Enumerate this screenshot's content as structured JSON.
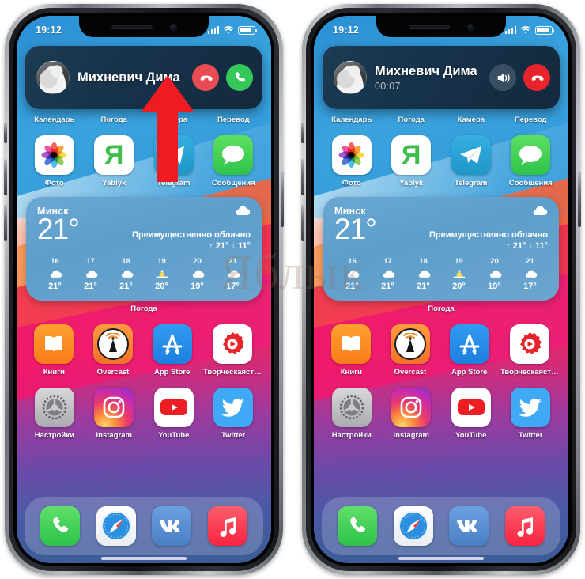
{
  "meta": {
    "watermark": "Яблык"
  },
  "phones": [
    {
      "id": "left",
      "status": {
        "time": "19:12",
        "signal_icon": "signal-bars-icon",
        "wifi_icon": "wifi-icon",
        "battery_icon": "battery-icon"
      },
      "call_banner": {
        "state": "incoming",
        "caller_name": "Михневич Дима",
        "timer": "",
        "avatar_name": "caller-avatar",
        "buttons": [
          {
            "name": "decline-call-button",
            "icon": "phone-down-icon",
            "color": "#e94b53"
          },
          {
            "name": "accept-call-button",
            "icon": "phone-icon",
            "color": "#34c759"
          }
        ]
      },
      "annotation": {
        "arrow": "red-up-arrow",
        "color": "#ee1c22",
        "points_to": "accept-call-button"
      }
    },
    {
      "id": "right",
      "status": {
        "time": "19:12",
        "signal_icon": "signal-bars-icon",
        "wifi_icon": "wifi-icon",
        "battery_icon": "battery-icon"
      },
      "call_banner": {
        "state": "active",
        "caller_name": "Михневич Дима",
        "timer": "00:07",
        "avatar_name": "caller-avatar",
        "buttons": [
          {
            "name": "speaker-button",
            "icon": "speaker-icon",
            "color": "rgba(255,255,255,.16)"
          },
          {
            "name": "end-call-button",
            "icon": "phone-down-icon",
            "color": "#e7232b"
          }
        ]
      },
      "annotation": null
    }
  ],
  "home": {
    "top_row_labels": [
      "Календарь",
      "Погода",
      "Камера",
      "Перевод"
    ],
    "row1": [
      {
        "label": "Фото",
        "icon": "photos-icon"
      },
      {
        "label": "Yablyk",
        "icon": "yablyk-icon"
      },
      {
        "label": "Telegram",
        "icon": "telegram-icon"
      },
      {
        "label": "Сообщения",
        "icon": "messages-icon"
      }
    ],
    "row2": [
      {
        "label": "Книги",
        "icon": "books-icon"
      },
      {
        "label": "Overcast",
        "icon": "overcast-icon"
      },
      {
        "label": "App Store",
        "icon": "appstore-icon"
      },
      {
        "label": "Творческаясту…",
        "icon": "creative-studio-icon"
      }
    ],
    "row3": [
      {
        "label": "Настройки",
        "icon": "settings-icon"
      },
      {
        "label": "Instagram",
        "icon": "instagram-icon"
      },
      {
        "label": "YouTube",
        "icon": "youtube-icon"
      },
      {
        "label": "Twitter",
        "icon": "twitter-icon"
      }
    ],
    "dock": [
      {
        "label": "Телефон",
        "icon": "phone-app-icon"
      },
      {
        "label": "Safari",
        "icon": "safari-icon"
      },
      {
        "label": "ВКонтакте",
        "icon": "vk-icon"
      },
      {
        "label": "Музыка",
        "icon": "music-icon"
      }
    ]
  },
  "weather_widget": {
    "city": "Минск",
    "temperature": "21°",
    "condition": "Преимущественно облачно",
    "high_low": "↑ 21° ↓ 11°",
    "widget_label": "Погода",
    "hours": [
      {
        "time": "16",
        "icon": "cloud-icon",
        "temp": "21°"
      },
      {
        "time": "17",
        "icon": "cloud-icon",
        "temp": "21°"
      },
      {
        "time": "18",
        "icon": "cloud-icon",
        "temp": "21°"
      },
      {
        "time": "19",
        "icon": "sunset-icon",
        "temp": "20°"
      },
      {
        "time": "20",
        "icon": "cloud-icon",
        "temp": "19°"
      },
      {
        "time": "21",
        "icon": "cloud-icon",
        "temp": "17°"
      }
    ]
  }
}
